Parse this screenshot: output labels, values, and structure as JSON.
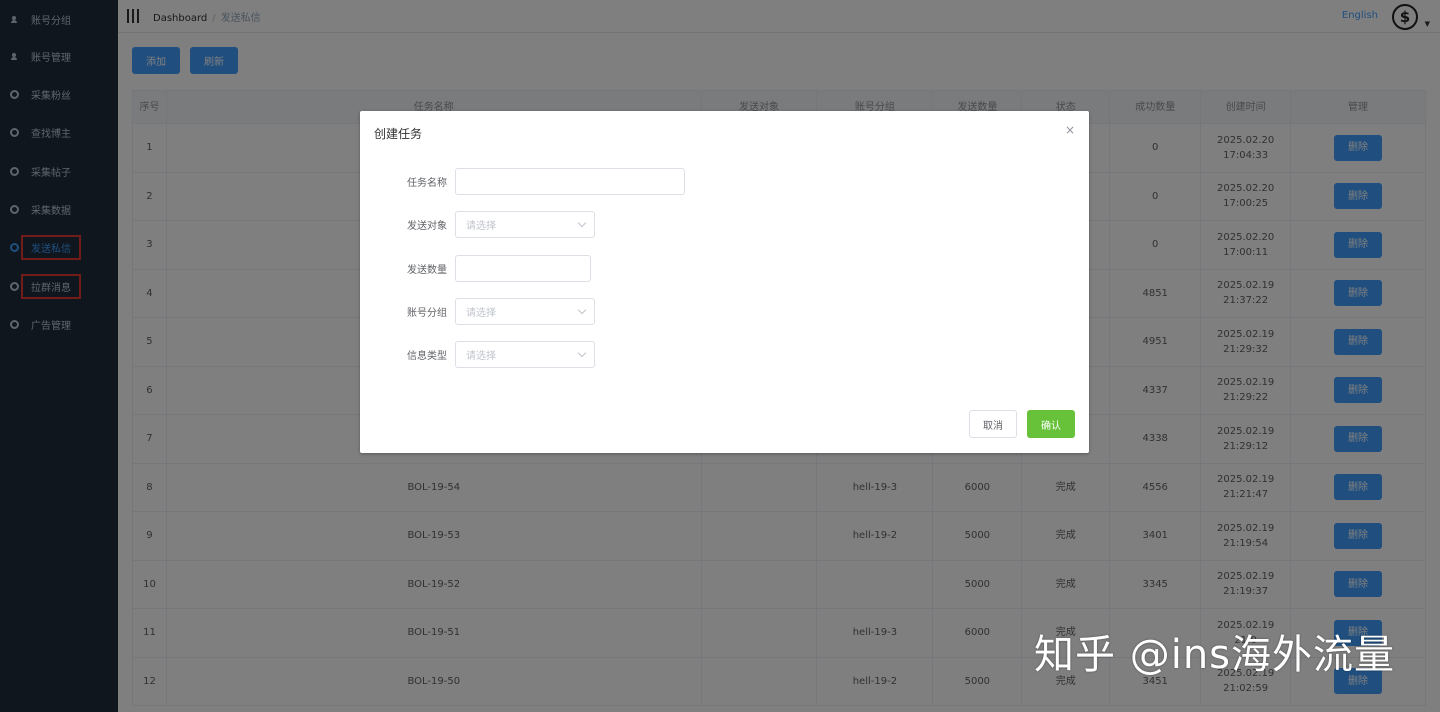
{
  "colors": {
    "sidebar_bg": "#1f2d3d",
    "primary": "#409eff",
    "success": "#67c23a",
    "highlight_border": "#e53935"
  },
  "sidebar": {
    "items": [
      {
        "label": "账号分组",
        "icon": "user-icon"
      },
      {
        "label": "账号管理",
        "icon": "user-icon"
      },
      {
        "label": "采集粉丝",
        "icon": "ring-icon"
      },
      {
        "label": "查找博主",
        "icon": "ring-icon"
      },
      {
        "label": "采集帖子",
        "icon": "ring-icon"
      },
      {
        "label": "采集数据",
        "icon": "ring-icon"
      },
      {
        "label": "发送私信",
        "icon": "ring-icon",
        "active": true,
        "highlighted": true
      },
      {
        "label": "拉群消息",
        "icon": "ring-icon",
        "highlighted": true
      },
      {
        "label": "广告管理",
        "icon": "ring-icon"
      }
    ]
  },
  "header": {
    "breadcrumb_root": "Dashboard",
    "breadcrumb_sep": "/",
    "breadcrumb_current": "发送私信",
    "language": "English",
    "avatar_glyph": "$"
  },
  "toolbar": {
    "add_label": "添加",
    "refresh_label": "刷新"
  },
  "table": {
    "columns": [
      "序号",
      "任务名称",
      "发送对象",
      "账号分组",
      "发送数量",
      "状态",
      "成功数量",
      "创建时间",
      "管理"
    ],
    "delete_label": "删除",
    "rows": [
      {
        "no": "1",
        "name": "",
        "target": "",
        "group": "",
        "count": "",
        "status": "",
        "success": "0",
        "created": "2025.02.20 17:04:33"
      },
      {
        "no": "2",
        "name": "",
        "target": "",
        "group": "",
        "count": "",
        "status": "",
        "success": "0",
        "created": "2025.02.20 17:00:25"
      },
      {
        "no": "3",
        "name": "",
        "target": "",
        "group": "",
        "count": "",
        "status": "",
        "success": "0",
        "created": "2025.02.20 17:00:11"
      },
      {
        "no": "4",
        "name": "",
        "target": "",
        "group": "",
        "count": "",
        "status": "",
        "success": "4851",
        "created": "2025.02.19 21:37:22"
      },
      {
        "no": "5",
        "name": "",
        "target": "",
        "group": "",
        "count": "",
        "status": "",
        "success": "4951",
        "created": "2025.02.19 21:29:32"
      },
      {
        "no": "6",
        "name": "",
        "target": "",
        "group": "",
        "count": "",
        "status": "",
        "success": "4337",
        "created": "2025.02.19 21:29:22"
      },
      {
        "no": "7",
        "name": "",
        "target": "",
        "group": "",
        "count": "",
        "status": "",
        "success": "4338",
        "created": "2025.02.19 21:29:12"
      },
      {
        "no": "8",
        "name": "BOL-19-54",
        "target": "",
        "group": "hell-19-3",
        "count": "6000",
        "status": "完成",
        "success": "4556",
        "created": "2025.02.19 21:21:47"
      },
      {
        "no": "9",
        "name": "BOL-19-53",
        "target": "",
        "group": "hell-19-2",
        "count": "5000",
        "status": "完成",
        "success": "3401",
        "created": "2025.02.19 21:19:54"
      },
      {
        "no": "10",
        "name": "BOL-19-52",
        "target": "",
        "group": "",
        "count": "5000",
        "status": "完成",
        "success": "3345",
        "created": "2025.02.19 21:19:37"
      },
      {
        "no": "11",
        "name": "BOL-19-51",
        "target": "",
        "group": "hell-19-3",
        "count": "6000",
        "status": "完成",
        "success": "",
        "created": "2025.02.19 21:0"
      },
      {
        "no": "12",
        "name": "BOL-19-50",
        "target": "",
        "group": "hell-19-2",
        "count": "5000",
        "status": "完成",
        "success": "3451",
        "created": "2025.02.19 21:02:59"
      }
    ]
  },
  "dialog": {
    "title": "创建任务",
    "close_glyph": "×",
    "fields": [
      {
        "label": "任务名称",
        "type": "text",
        "value": ""
      },
      {
        "label": "发送对象",
        "type": "select",
        "placeholder": "请选择"
      },
      {
        "label": "发送数量",
        "type": "text",
        "value": ""
      },
      {
        "label": "账号分组",
        "type": "select",
        "placeholder": "请选择"
      },
      {
        "label": "信息类型",
        "type": "select",
        "placeholder": "请选择"
      }
    ],
    "cancel_label": "取消",
    "confirm_label": "确认"
  },
  "watermark": "知乎 @ins海外流量"
}
